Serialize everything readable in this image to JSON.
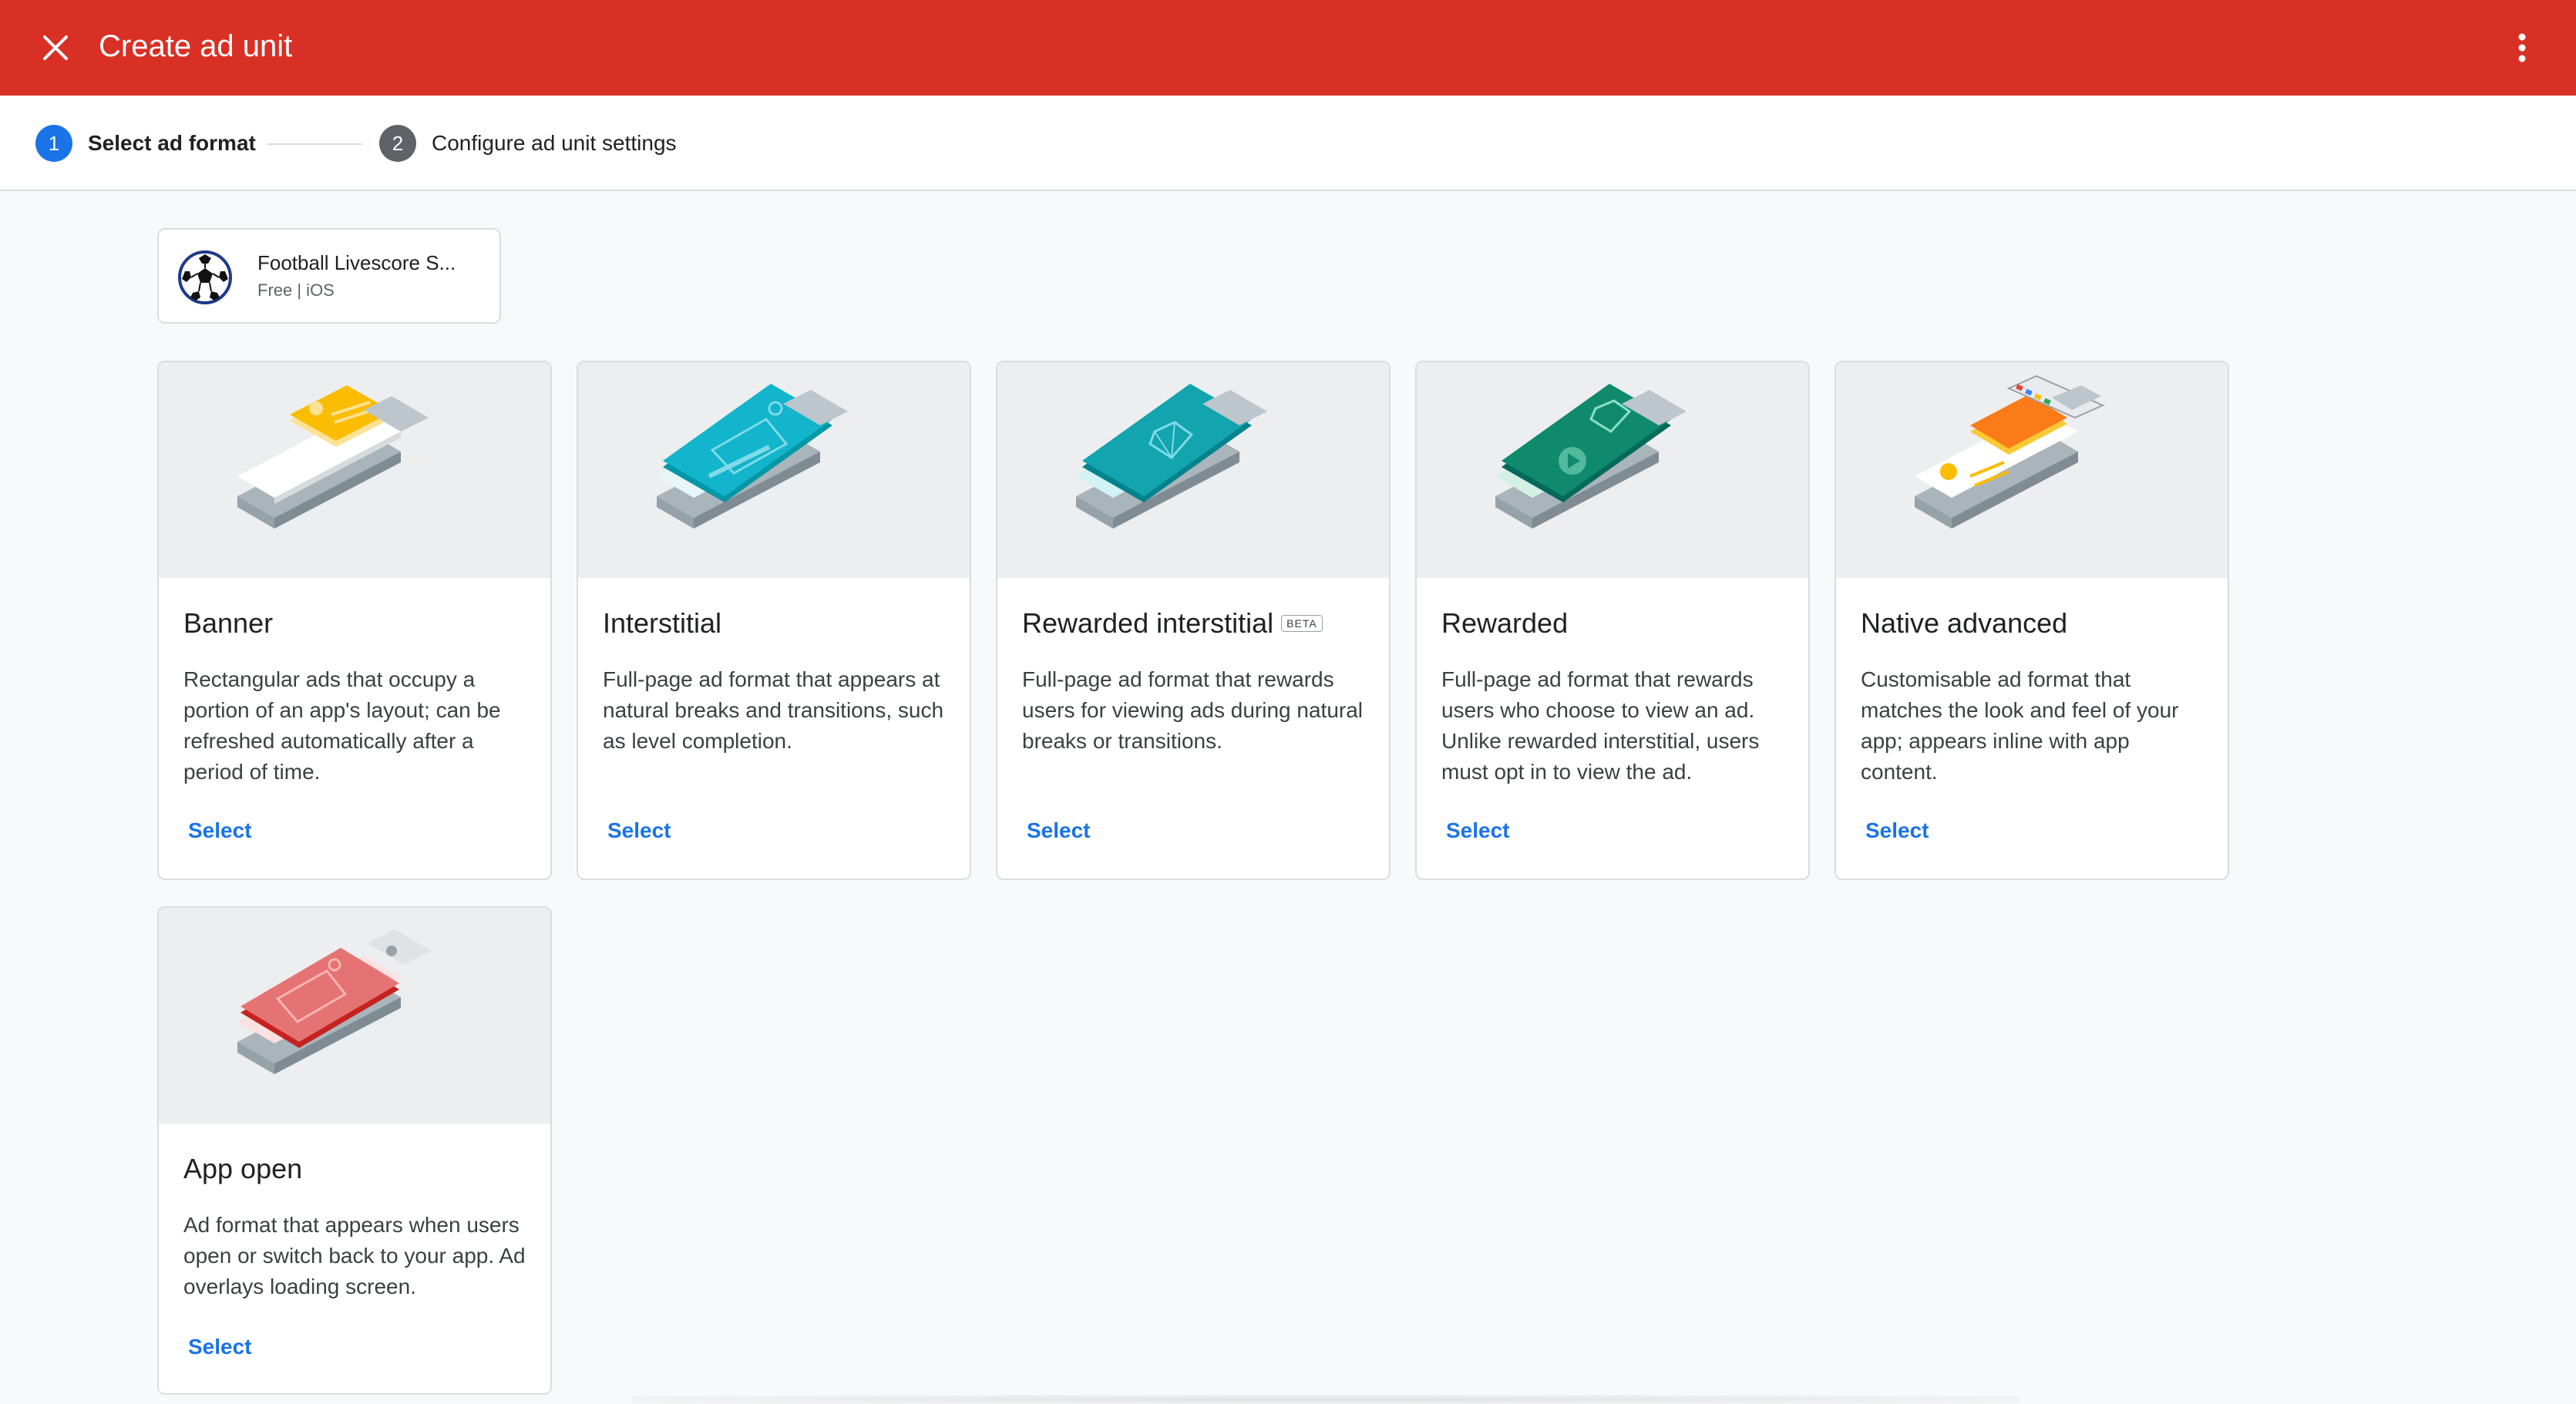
{
  "header": {
    "title": "Create ad unit",
    "close_icon": "close-icon",
    "more_icon": "more-vert-icon"
  },
  "stepper": {
    "steps": [
      {
        "number": "1",
        "label": "Select ad format"
      },
      {
        "number": "2",
        "label": "Configure ad unit settings"
      }
    ]
  },
  "app": {
    "name": "Football Livescore S...",
    "meta": "Free | iOS",
    "icon": "soccer-ball-icon"
  },
  "formats": [
    {
      "title": "Banner",
      "badge": "",
      "description": "Rectangular ads that occupy a portion of an app's layout; can be refreshed automatically after a period of time.",
      "select_label": "Select"
    },
    {
      "title": "Interstitial",
      "badge": "",
      "description": "Full-page ad format that appears at natural breaks and transitions, such as level completion.",
      "select_label": "Select"
    },
    {
      "title": "Rewarded interstitial",
      "badge": "BETA",
      "description": "Full-page ad format that rewards users for viewing ads during natural breaks or transitions.",
      "select_label": "Select"
    },
    {
      "title": "Rewarded",
      "badge": "",
      "description": "Full-page ad format that rewards users who choose to view an ad. Unlike rewarded interstitial, users must opt in to view the ad.",
      "select_label": "Select"
    },
    {
      "title": "Native advanced",
      "badge": "",
      "description": "Customisable ad format that matches the look and feel of your app; appears inline with app content.",
      "select_label": "Select"
    },
    {
      "title": "App open",
      "badge": "",
      "description": "Ad format that appears when users open or switch back to your app. Ad overlays loading screen.",
      "select_label": "Select"
    }
  ],
  "colors": {
    "appbar": "#d93025",
    "step_active": "#1a73e8",
    "step_inactive": "#5f6368",
    "link": "#1a73e8"
  }
}
